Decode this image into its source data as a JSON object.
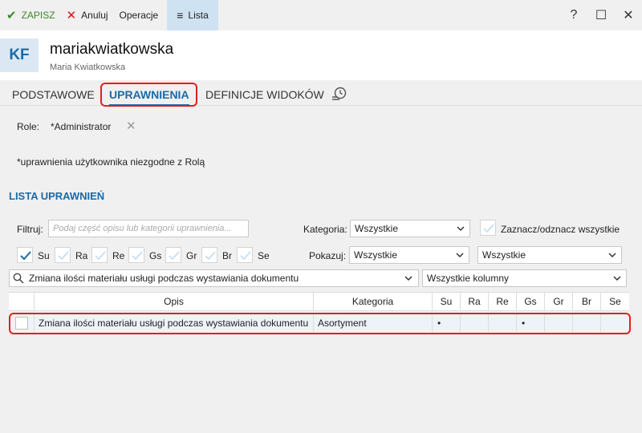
{
  "toolbar": {
    "save_label": "ZAPISZ",
    "cancel_label": "Anuluj",
    "operations_label": "Operacje",
    "list_label": "Lista"
  },
  "window": {
    "help": "?",
    "maximize": "☐",
    "close": "✕"
  },
  "user": {
    "initials": "KF",
    "login": "mariakwiatkowska",
    "full_name": "Maria Kwiatkowska"
  },
  "tabs": [
    {
      "label": "PODSTAWOWE",
      "active": false
    },
    {
      "label": "UPRAWNIENIA",
      "active": true
    },
    {
      "label": "DEFINICJE WIDOKÓW",
      "active": false
    }
  ],
  "role": {
    "label": "Role:",
    "value": "*Administrator"
  },
  "note": "*uprawnienia użytkownika niezgodne z Rolą",
  "section_title": "LISTA UPRAWNIEŃ",
  "filters": {
    "filter_label": "Filtruj:",
    "filter_placeholder": "Podaj część opisu lub kategorii uprawnienia...",
    "category_label": "Kategoria:",
    "category_value": "Wszystkie",
    "toggle_all_label": "Zaznacz/odznacz wszystkie",
    "show_label": "Pokazuj:",
    "show_value": "Wszystkie",
    "show_value2": "Wszystkie",
    "search_value": "Zmiana ilości materiału usługi podczas wystawiania dokumentu",
    "columns_value": "Wszystkie kolumny"
  },
  "perm_checks": [
    {
      "label": "Su",
      "checked": true
    },
    {
      "label": "Ra",
      "checked": false
    },
    {
      "label": "Re",
      "checked": false
    },
    {
      "label": "Gs",
      "checked": false
    },
    {
      "label": "Gr",
      "checked": false
    },
    {
      "label": "Br",
      "checked": false
    },
    {
      "label": "Se",
      "checked": false
    }
  ],
  "table": {
    "columns": [
      "Opis",
      "Kategoria",
      "Su",
      "Ra",
      "Re",
      "Gs",
      "Gr",
      "Br",
      "Se"
    ],
    "rows": [
      {
        "opis": "Zmiana ilości materiału usługi podczas wystawiania dokumentu",
        "kategoria": "Asortyment",
        "su": "•",
        "ra": "",
        "re": "",
        "gs": "•",
        "gr": "",
        "br": "",
        "se": ""
      }
    ]
  },
  "colors": {
    "accent": "#1b6aa5",
    "save": "#3a8a26",
    "cancel": "#d01818",
    "highlight": "#e02020"
  }
}
